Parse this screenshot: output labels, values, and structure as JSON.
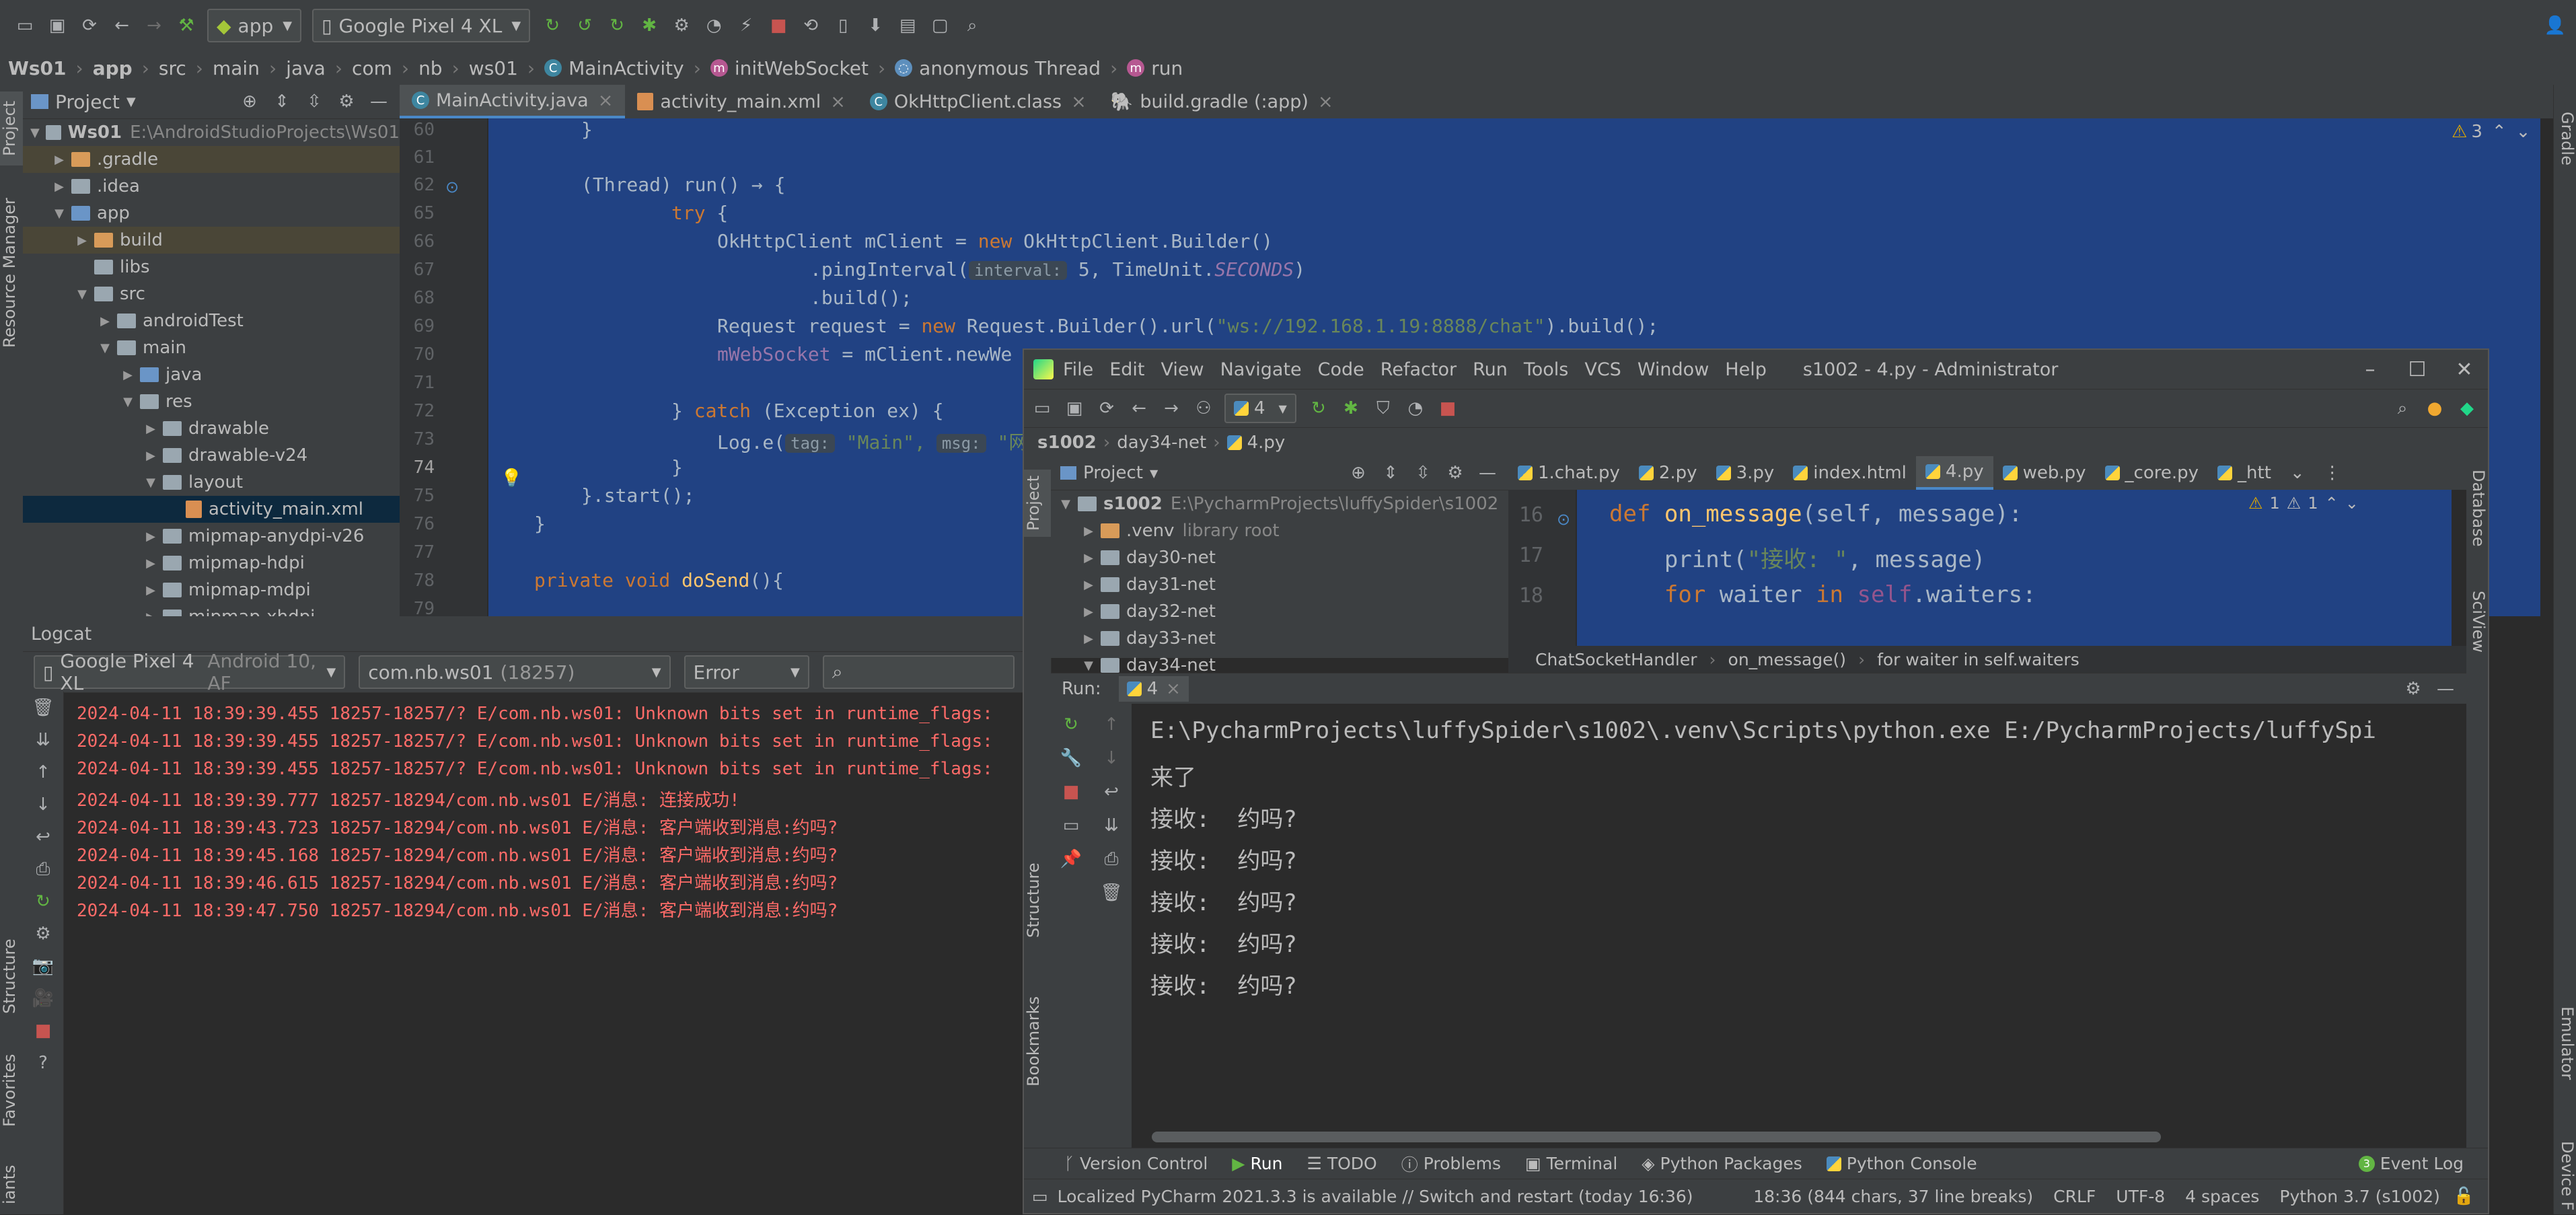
{
  "as_toolbar": {
    "run_config": "app",
    "device": "Google Pixel 4 XL"
  },
  "as_breadcrumb": [
    "Ws01",
    "app",
    "src",
    "main",
    "java",
    "com",
    "nb",
    "ws01",
    "MainActivity",
    "initWebSocket",
    "anonymous Thread",
    "run"
  ],
  "left_stripe": {
    "project": "Project",
    "resource_manager": "Resource Manager",
    "structure": "Structure",
    "favorites": "Favorites",
    "variants": "iants"
  },
  "right_stripe": {
    "gradle": "Gradle",
    "emulator": "Emulator",
    "device_file": "Device F"
  },
  "project_panel": {
    "title": "Project",
    "tree": [
      {
        "label": "Ws01",
        "extra": "E:\\AndroidStudioProjects\\Ws01",
        "depth": 0,
        "expanded": true,
        "icon": "folder"
      },
      {
        "label": ".gradle",
        "depth": 1,
        "expanded": false,
        "icon": "folder-orange",
        "highlight": true
      },
      {
        "label": ".idea",
        "depth": 1,
        "expanded": false,
        "icon": "folder"
      },
      {
        "label": "app",
        "depth": 1,
        "expanded": true,
        "icon": "folder-blue"
      },
      {
        "label": "build",
        "depth": 2,
        "expanded": false,
        "icon": "folder-orange",
        "highlight": true
      },
      {
        "label": "libs",
        "depth": 2,
        "expanded": null,
        "icon": "folder"
      },
      {
        "label": "src",
        "depth": 2,
        "expanded": true,
        "icon": "folder"
      },
      {
        "label": "androidTest",
        "depth": 3,
        "expanded": false,
        "icon": "folder"
      },
      {
        "label": "main",
        "depth": 3,
        "expanded": true,
        "icon": "folder"
      },
      {
        "label": "java",
        "depth": 4,
        "expanded": false,
        "icon": "folder-blue"
      },
      {
        "label": "res",
        "depth": 4,
        "expanded": true,
        "icon": "folder"
      },
      {
        "label": "drawable",
        "depth": 5,
        "expanded": false,
        "icon": "folder"
      },
      {
        "label": "drawable-v24",
        "depth": 5,
        "expanded": false,
        "icon": "folder"
      },
      {
        "label": "layout",
        "depth": 5,
        "expanded": true,
        "icon": "folder"
      },
      {
        "label": "activity_main.xml",
        "depth": 6,
        "expanded": null,
        "icon": "xml",
        "selected": true
      },
      {
        "label": "mipmap-anydpi-v26",
        "depth": 5,
        "expanded": false,
        "icon": "folder"
      },
      {
        "label": "mipmap-hdpi",
        "depth": 5,
        "expanded": false,
        "icon": "folder"
      },
      {
        "label": "mipmap-mdpi",
        "depth": 5,
        "expanded": false,
        "icon": "folder"
      },
      {
        "label": "mipmap-xhdpi",
        "depth": 5,
        "expanded": false,
        "icon": "folder"
      }
    ]
  },
  "editor_tabs": [
    {
      "label": "MainActivity.java",
      "active": true
    },
    {
      "label": "activity_main.xml",
      "active": false
    },
    {
      "label": "OkHttpClient.class",
      "active": false
    },
    {
      "label": "build.gradle (:app)",
      "active": false
    }
  ],
  "editor": {
    "warnings": "3",
    "line_numbers": [
      "60",
      "61",
      "62",
      "65",
      "66",
      "67",
      "68",
      "69",
      "70",
      "71",
      "72",
      "73",
      "74",
      "75",
      "76",
      "77",
      "78",
      "79"
    ]
  },
  "code": {
    "l60": "}",
    "l62a": "(Thread) run() ",
    "l62b": "→ {",
    "l65kw": "try",
    "l65b": " {",
    "l66a": "OkHttpClient mClient = ",
    "l66kw": "new",
    "l66b": " OkHttpClient.Builder()",
    "l67a": ".pingInterval(",
    "l67hint": "interval:",
    "l67b": " 5, TimeUnit.",
    "l67c": "SECONDS",
    "l67d": ")",
    "l68": ".build();",
    "l69a": "Request request = ",
    "l69kw": "new",
    "l69b": " Request.Builder().url(",
    "l69str": "\"ws://192.168.1.19:8888/chat\"",
    "l69c": ").build();",
    "l70a": "mWebSocket",
    "l70b": " = mClient.newWe",
    "l72a": "} ",
    "l72kw": "catch",
    "l72b": " (Exception ex) {",
    "l73a": "Log.e(",
    "l73hint1": "tag:",
    "l73str": " \"Main\",",
    "l73hint2": "msg:",
    "l73str2": " \"网",
    "l74": "}",
    "l75": "}.start();",
    "l76": "}",
    "l78kw": "private void",
    "l78fn": " doSend",
    "l78b": "(){"
  },
  "logcat": {
    "title": "Logcat",
    "device": "Google Pixel 4 XL",
    "device_extra": "Android 10, AF",
    "process": "com.nb.ws01",
    "process_extra": "(18257)",
    "level": "Error",
    "lines": [
      "2024-04-11 18:39:39.455 18257-18257/? E/com.nb.ws01: Unknown bits set in runtime_flags:",
      "2024-04-11 18:39:39.455 18257-18257/? E/com.nb.ws01: Unknown bits set in runtime_flags:",
      "2024-04-11 18:39:39.455 18257-18257/? E/com.nb.ws01: Unknown bits set in runtime_flags:",
      "2024-04-11 18:39:39.777 18257-18294/com.nb.ws01 E/消息: 连接成功!",
      "2024-04-11 18:39:43.723 18257-18294/com.nb.ws01 E/消息: 客户端收到消息:约吗?",
      "2024-04-11 18:39:45.168 18257-18294/com.nb.ws01 E/消息: 客户端收到消息:约吗?",
      "2024-04-11 18:39:46.615 18257-18294/com.nb.ws01 E/消息: 客户端收到消息:约吗?",
      "2024-04-11 18:39:47.750 18257-18294/com.nb.ws01 E/消息: 客户端收到消息:约吗?"
    ]
  },
  "pycharm": {
    "menu": [
      "File",
      "Edit",
      "View",
      "Navigate",
      "Code",
      "Refactor",
      "Run",
      "Tools",
      "VCS",
      "Window",
      "Help"
    ],
    "title": "s1002 - 4.py - Administrator",
    "run_config": "4",
    "breadcrumb": [
      "s1002",
      "day34-net",
      "4.py"
    ],
    "project_title": "Project",
    "tree": [
      {
        "label": "s1002",
        "extra": "E:\\PycharmProjects\\luffySpider\\s1002",
        "depth": 0,
        "expanded": true
      },
      {
        "label": ".venv",
        "extra": "library root",
        "depth": 1,
        "expanded": false
      },
      {
        "label": "day30-net",
        "depth": 1,
        "expanded": false
      },
      {
        "label": "day31-net",
        "depth": 1,
        "expanded": false
      },
      {
        "label": "day32-net",
        "depth": 1,
        "expanded": false
      },
      {
        "label": "day33-net",
        "depth": 1,
        "expanded": false
      },
      {
        "label": "day34-net",
        "depth": 1,
        "expanded": true
      }
    ],
    "tabs": [
      {
        "label": "1.chat.py",
        "active": false
      },
      {
        "label": "2.py",
        "active": false
      },
      {
        "label": "3.py",
        "active": false
      },
      {
        "label": "index.html",
        "active": false
      },
      {
        "label": "4.py",
        "active": true
      },
      {
        "label": "web.py",
        "active": false
      },
      {
        "label": "_core.py",
        "active": false
      },
      {
        "label": "_htt",
        "active": false
      }
    ],
    "inspections": {
      "warn1": "1",
      "warn2": "1"
    },
    "code_lines": [
      {
        "num": "16",
        "text_kw": "def",
        "text_fn": " on_message",
        "text_rest": "(self, message):"
      },
      {
        "num": "17",
        "text_a": "    print(",
        "text_str": "\"接收: \"",
        "text_rest": ", message)"
      },
      {
        "num": "18",
        "text_kw": "    for",
        "text_rest": " waiter ",
        "text_kw2": "in",
        "text_self": " self",
        "text_rest2": ".waiters:"
      }
    ],
    "code_crumb": [
      "ChatSocketHandler",
      "on_message()",
      "for waiter in self.waiters"
    ],
    "run_label": "Run:",
    "run_tab": "4",
    "console": [
      "E:\\PycharmProjects\\luffySpider\\s1002\\.venv\\Scripts\\python.exe E:/PycharmProjects/luffySpi",
      "来了",
      "接收:  约吗?",
      "接收:  约吗?",
      "接收:  约吗?",
      "接收:  约吗?",
      "接收:  约吗?"
    ],
    "left_stripe": {
      "project": "Project",
      "structure": "Structure",
      "bookmarks": "Bookmarks"
    },
    "right_stripe": {
      "database": "Database",
      "sciview": "SciView"
    },
    "bottom_tabs": [
      "Version Control",
      "Run",
      "TODO",
      "Problems",
      "Terminal",
      "Python Packages",
      "Python Console"
    ],
    "event_log": "Event Log",
    "event_count": "3",
    "status_msg": "Localized PyCharm 2021.3.3 is available // Switch and restart (today 16:36)",
    "status_pos": "18:36 (844 chars, 37 line breaks)",
    "status_crlf": "CRLF",
    "status_enc": "UTF-8",
    "status_indent": "4 spaces",
    "status_interp": "Python 3.7 (s1002)"
  }
}
